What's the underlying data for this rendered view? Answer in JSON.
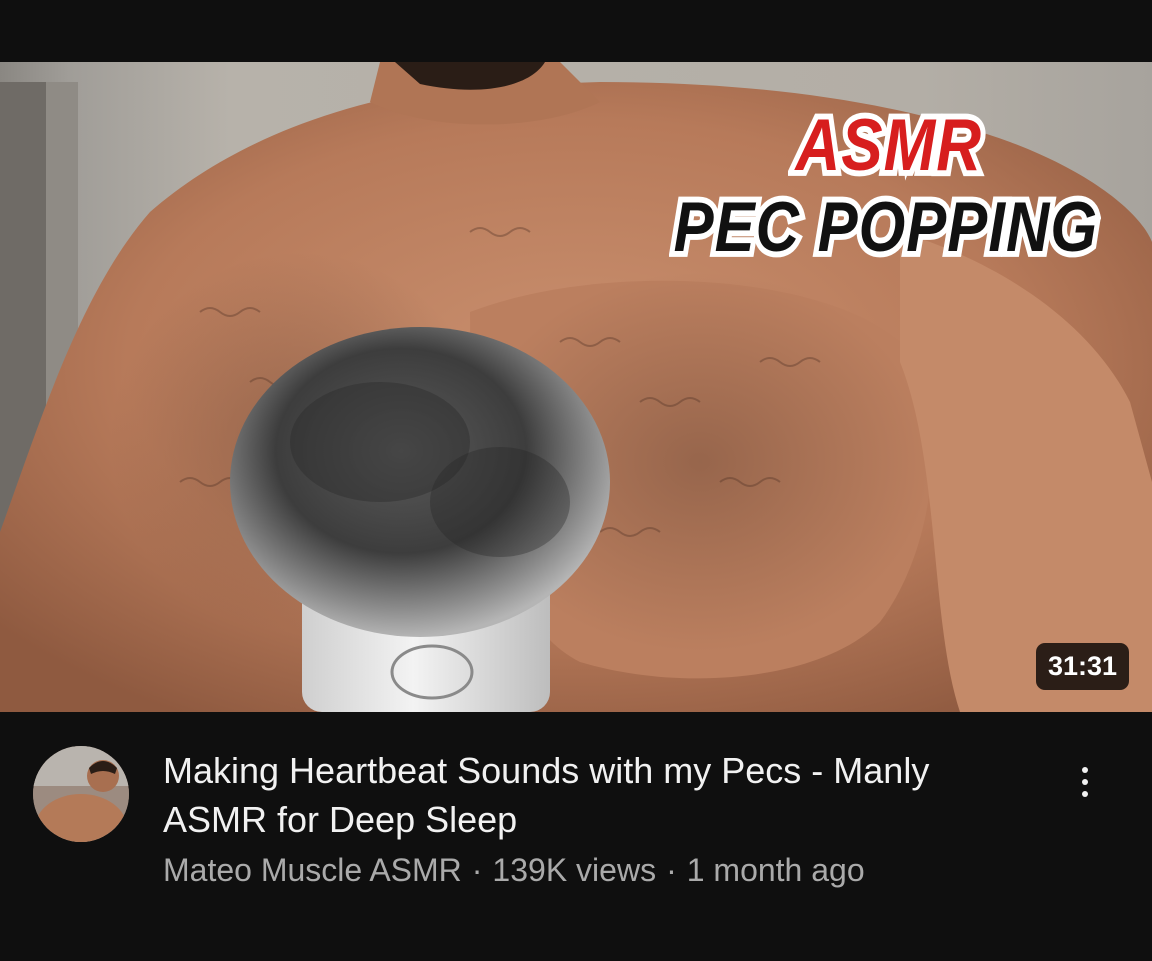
{
  "video": {
    "thumbnail": {
      "overlay_line1": "ASMR",
      "overlay_line2": "PEC POPPING",
      "duration": "31:31"
    },
    "title": "Making Heartbeat Sounds with my Pecs - Manly ASMR for Deep Sleep",
    "channel": "Mateo Muscle ASMR",
    "separator": "·",
    "views": "139K views",
    "age": "1 month ago"
  },
  "icons": {
    "more": "more-vert-icon",
    "avatar": "channel-avatar"
  },
  "colors": {
    "background": "#0f0f0f",
    "title_text": "#f1f1f1",
    "meta_text": "#aaaaaa",
    "overlay_red": "#d71e1e",
    "overlay_black": "#111111"
  }
}
